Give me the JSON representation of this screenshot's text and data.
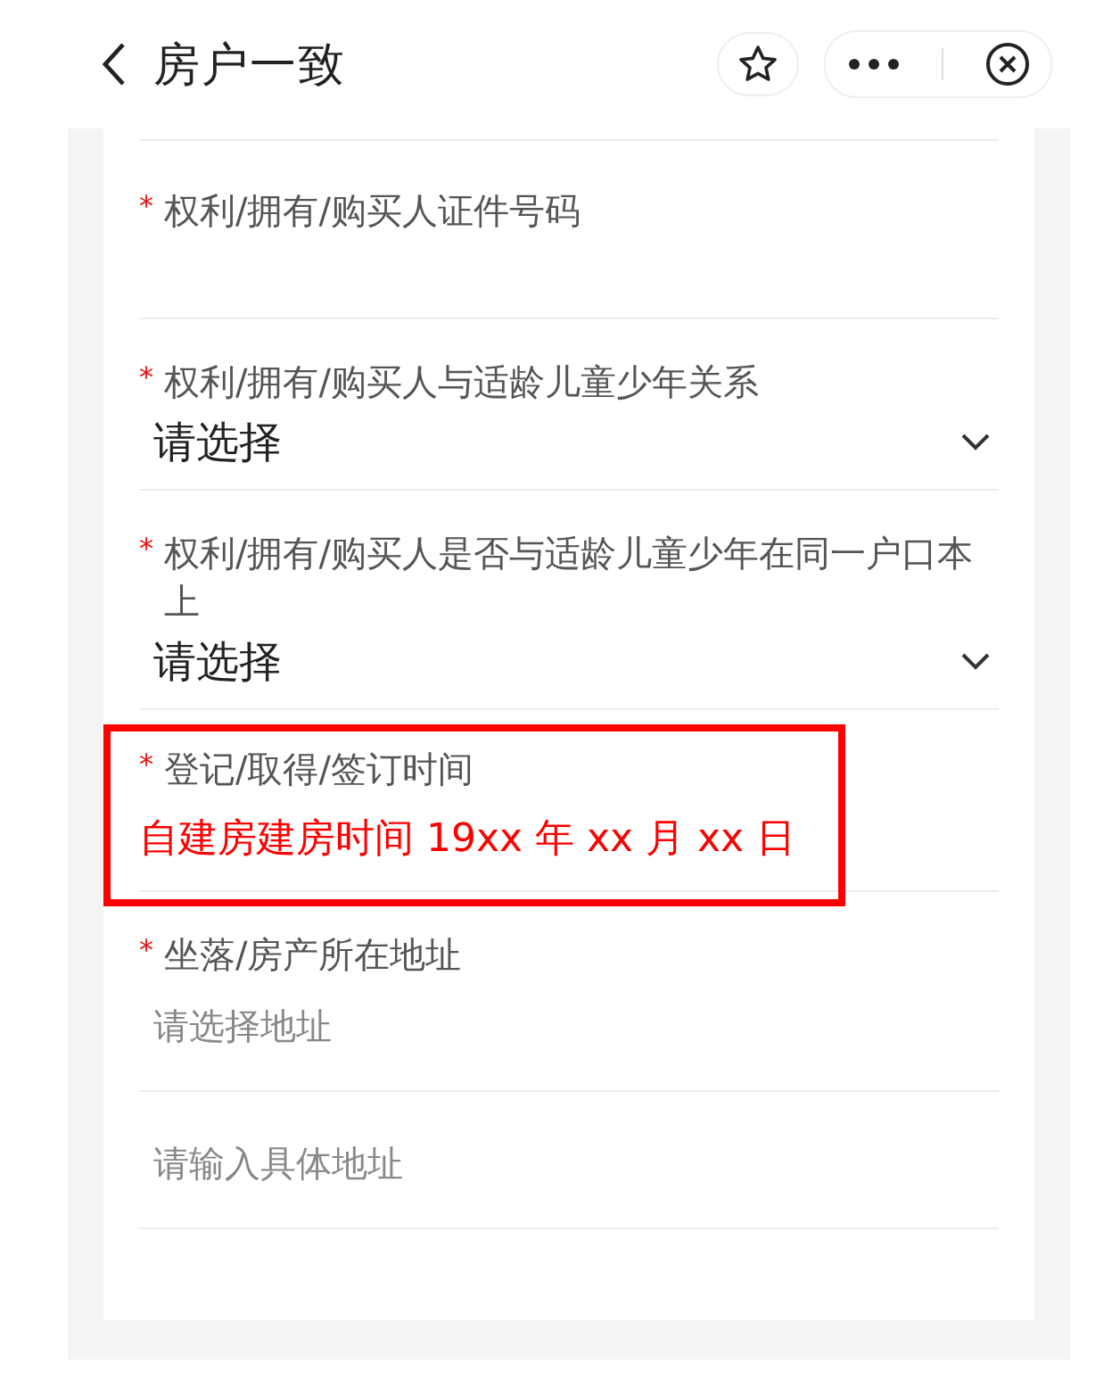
{
  "header": {
    "title": "房户一致"
  },
  "fields": [
    {
      "kind": "input",
      "mark": "*",
      "label": "权利/拥有/购买人证件号码",
      "highlighted": false
    },
    {
      "kind": "select",
      "mark": "*",
      "label": "权利/拥有/购买人与适龄儿童少年关系",
      "placeholder": "请选择",
      "highlighted": false
    },
    {
      "kind": "select",
      "mark": "*",
      "label": "权利/拥有/购买人是否与适龄儿童少年在同一户口本上",
      "placeholder": "请选择",
      "highlighted": false
    },
    {
      "kind": "text",
      "mark": "*",
      "label": "登记/取得/签订时间",
      "value": "自建房建房时间 19xx 年 xx 月 xx 日",
      "highlighted": true
    },
    {
      "kind": "address",
      "mark": "*",
      "label": "坐落/房产所在地址",
      "placeholders": [
        "请选择地址",
        "请输入具体地址"
      ],
      "highlighted": false
    }
  ]
}
